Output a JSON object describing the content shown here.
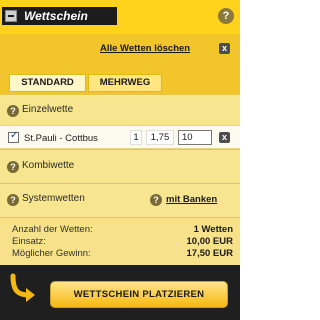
{
  "header": {
    "title": "Wettschein",
    "help": "?"
  },
  "delete_all": {
    "label": "Alle Wetten löschen",
    "x": "x"
  },
  "tabs": [
    {
      "label": "STANDARD",
      "active": true
    },
    {
      "label": "MEHRWEG",
      "active": false
    }
  ],
  "sections": {
    "single": {
      "label": "Einzelwette",
      "help": "?"
    },
    "combi": {
      "label": "Kombiwette",
      "help": "?"
    },
    "system": {
      "label": "Systemwetten",
      "help": "?",
      "link_help": "?",
      "link": "mit Banken"
    }
  },
  "bet": {
    "checked": true,
    "match": "St.Pauli - Cottbus",
    "tip": "1",
    "odds": "1,75",
    "stake": "10",
    "remove": "x"
  },
  "summary": {
    "count_label": "Anzahl der Wetten:",
    "count_value": "1 Wetten",
    "stake_label": "Einsatz:",
    "stake_value": "10,00 EUR",
    "win_label": "Möglicher Gewinn:",
    "win_value": "17,50 EUR"
  },
  "footer": {
    "place_label": "WETTSCHEIN PLATZIEREN"
  },
  "colors": {
    "accent": "#f2c52a",
    "dark": "#1f1f1f",
    "button": "#f5b811"
  }
}
